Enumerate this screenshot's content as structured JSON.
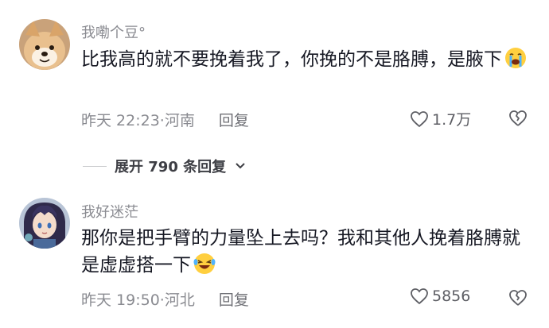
{
  "comments": [
    {
      "username": "我嘞个豆°",
      "text": "比我高的就不要挽着我了，你挽的不是胳膊，是腋下",
      "emoji": "crying-face",
      "time": "昨天 22:23",
      "location": "河南",
      "reply_label": "回复",
      "likes": "1.7万"
    },
    {
      "username": "我好迷茫",
      "text": "那你是把手臂的力量坠上去吗？我和其他人挽着胳膊就是虚虚搭一下",
      "emoji": "laughing-tears-face",
      "time": "昨天 19:50",
      "location": "河北",
      "reply_label": "回复",
      "likes": "5856"
    }
  ],
  "expand": {
    "label": "展开 790 条回复"
  },
  "separator": "·"
}
